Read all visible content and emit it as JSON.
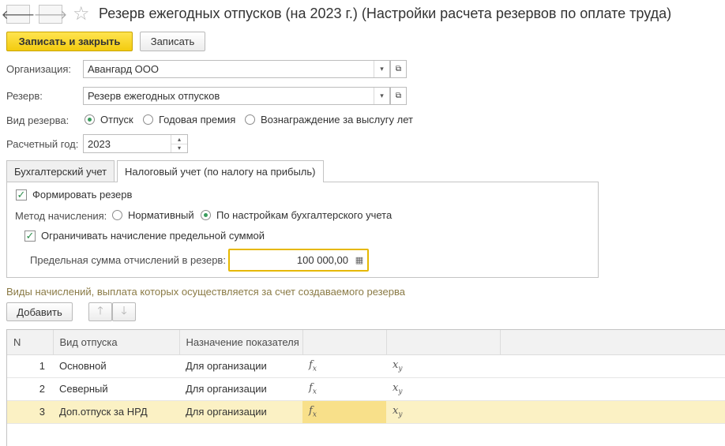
{
  "header": {
    "back_glyph": "🡐",
    "forward_glyph": "🡒",
    "star_glyph": "☆",
    "title": "Резерв ежегодных отпусков (на 2023 г.) (Настройки расчета резервов по оплате труда)"
  },
  "toolbar": {
    "save_close_label": "Записать и закрыть",
    "save_label": "Записать"
  },
  "form": {
    "organization_label": "Организация:",
    "organization_value": "Авангард ООО",
    "reserve_label": "Резерв:",
    "reserve_value": "Резерв ежегодных отпусков",
    "reserve_type_label": "Вид резерва:",
    "reserve_type_options": [
      "Отпуск",
      "Годовая премия",
      "Вознаграждение за выслугу лет"
    ],
    "year_label": "Расчетный год:",
    "year_value": "2023",
    "dropdown_glyph": "▾",
    "open_glyph": "⧉",
    "spin_up": "▴",
    "spin_down": "▾"
  },
  "tabs": {
    "accounting": "Бухгалтерский учет",
    "tax": "Налоговый учет (по налогу на прибыль)"
  },
  "tax_panel": {
    "form_reserve_label": "Формировать резерв",
    "method_label": "Метод начисления:",
    "method_options": [
      "Нормативный",
      "По настройкам бухгалтерского учета"
    ],
    "limit_label": "Ограничивать начисление предельной суммой",
    "limit_amount_label": "Предельная сумма отчислений в резерв:",
    "limit_amount_value": "100 000,00",
    "check_glyph": "✓",
    "calc_glyph": "▦"
  },
  "accruals": {
    "section_title": "Виды начислений, выплата которых осуществляется за счет создаваемого резерва",
    "add_label": "Добавить",
    "up_glyph": "🡑",
    "down_glyph": "🡓",
    "columns": [
      "N",
      "Вид отпуска",
      "Назначение показателя",
      "",
      ""
    ],
    "rows": [
      {
        "n": "1",
        "type": "Основной",
        "purpose": "Для организации"
      },
      {
        "n": "2",
        "type": "Северный",
        "purpose": "Для организации"
      },
      {
        "n": "3",
        "type": "Доп.отпуск за НРД",
        "purpose": "Для организации"
      }
    ],
    "fx_f": "f",
    "fx_sub": "x",
    "xy_x": "x",
    "xy_sub": "y"
  },
  "colors": {
    "primary_button": "#f3cb0f",
    "selected_row": "#fbf1c4",
    "radio_checked": "#3a9d5d",
    "active_field_border": "#e6b800"
  }
}
